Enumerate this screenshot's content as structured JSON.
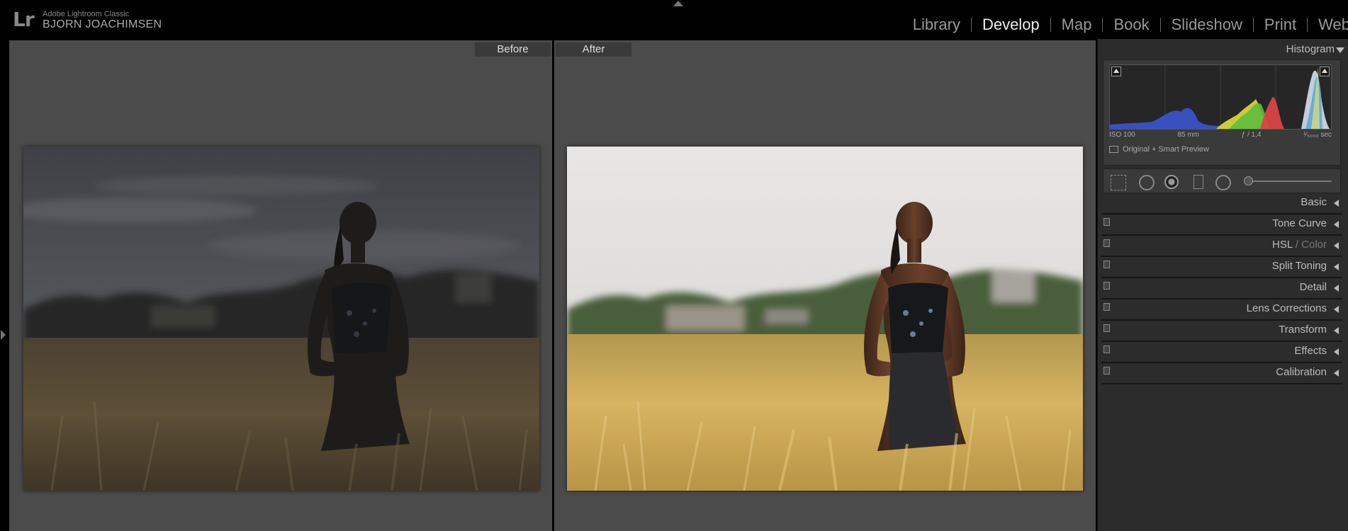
{
  "app": {
    "logo": "Lr",
    "name": "Adobe Lightroom Classic",
    "user": "BJORN JOACHIMSEN"
  },
  "modules": [
    {
      "label": "Library",
      "active": false
    },
    {
      "label": "Develop",
      "active": true
    },
    {
      "label": "Map",
      "active": false
    },
    {
      "label": "Book",
      "active": false
    },
    {
      "label": "Slideshow",
      "active": false
    },
    {
      "label": "Print",
      "active": false
    },
    {
      "label": "Web",
      "active": false
    }
  ],
  "views": {
    "before_label": "Before",
    "after_label": "After"
  },
  "histogram": {
    "title": "Histogram",
    "iso": "ISO 100",
    "focal": "85 mm",
    "aperture": "ƒ / 1,4",
    "shutter": "¹⁄₅₀₀₀ sec",
    "preview": "Original + Smart Preview"
  },
  "sections": {
    "basic": "Basic",
    "tone_curve": "Tone Curve",
    "hsl_a": "HSL",
    "hsl_b": " / Color",
    "split_toning": "Split Toning",
    "detail": "Detail",
    "lens_corrections": "Lens Corrections",
    "transform": "Transform",
    "effects": "Effects",
    "calibration": "Calibration"
  },
  "icons": {
    "crop": "crop-overlay-icon",
    "spot": "spot-removal-icon",
    "redeye": "red-eye-icon",
    "graduated": "graduated-filter-icon",
    "radial": "radial-filter-icon",
    "brush": "adjustment-brush-icon"
  },
  "colors": {
    "panel_bg": "#2c2c2c",
    "view_bg": "#4b4b4b",
    "active_module": "#eeeeee"
  }
}
